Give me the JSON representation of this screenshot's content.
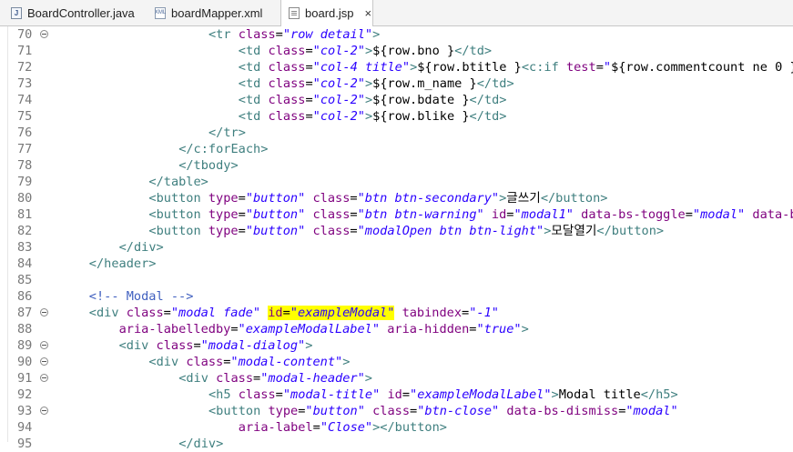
{
  "tabs": [
    {
      "label": "BoardController.java",
      "icon": "java-file-icon"
    },
    {
      "label": "boardMapper.xml",
      "icon": "xml-file-icon"
    },
    {
      "label": "board.jsp",
      "icon": "jsp-file-icon",
      "active": true,
      "close": "×"
    }
  ],
  "lines": [
    {
      "n": "70",
      "fold": true,
      "indent": 20,
      "segs": [
        [
          "t",
          "<tr "
        ],
        [
          "a",
          "class"
        ],
        [
          "plain",
          "="
        ],
        [
          "v",
          "\"row detail\""
        ],
        [
          "t",
          ">"
        ]
      ]
    },
    {
      "n": "71",
      "fold": false,
      "indent": 24,
      "segs": [
        [
          "t",
          "<td "
        ],
        [
          "a",
          "class"
        ],
        [
          "plain",
          "="
        ],
        [
          "v",
          "\"col-2\""
        ],
        [
          "t",
          ">"
        ],
        [
          "plain",
          "${row.bno }"
        ],
        [
          "t",
          "</td>"
        ]
      ]
    },
    {
      "n": "72",
      "fold": false,
      "indent": 24,
      "segs": [
        [
          "t",
          "<td "
        ],
        [
          "a",
          "class"
        ],
        [
          "plain",
          "="
        ],
        [
          "v",
          "\"col-4 title\""
        ],
        [
          "t",
          ">"
        ],
        [
          "plain",
          "${row.btitle }"
        ],
        [
          "t",
          "<c:if "
        ],
        [
          "a",
          "test"
        ],
        [
          "plain",
          "="
        ],
        [
          "v",
          "\""
        ],
        [
          "plain",
          "${row.commentcount ne 0 }"
        ],
        [
          "v",
          "\""
        ],
        [
          "t",
          ">"
        ],
        [
          "plain",
          "&"
        ]
      ]
    },
    {
      "n": "73",
      "fold": false,
      "indent": 24,
      "segs": [
        [
          "t",
          "<td "
        ],
        [
          "a",
          "class"
        ],
        [
          "plain",
          "="
        ],
        [
          "v",
          "\"col-2\""
        ],
        [
          "t",
          ">"
        ],
        [
          "plain",
          "${row.m_name }"
        ],
        [
          "t",
          "</td>"
        ]
      ]
    },
    {
      "n": "74",
      "fold": false,
      "indent": 24,
      "segs": [
        [
          "t",
          "<td "
        ],
        [
          "a",
          "class"
        ],
        [
          "plain",
          "="
        ],
        [
          "v",
          "\"col-2\""
        ],
        [
          "t",
          ">"
        ],
        [
          "plain",
          "${row.bdate }"
        ],
        [
          "t",
          "</td>"
        ]
      ]
    },
    {
      "n": "75",
      "fold": false,
      "indent": 24,
      "segs": [
        [
          "t",
          "<td "
        ],
        [
          "a",
          "class"
        ],
        [
          "plain",
          "="
        ],
        [
          "v",
          "\"col-2\""
        ],
        [
          "t",
          ">"
        ],
        [
          "plain",
          "${row.blike }"
        ],
        [
          "t",
          "</td>"
        ]
      ]
    },
    {
      "n": "76",
      "fold": false,
      "indent": 20,
      "segs": [
        [
          "t",
          "</tr>"
        ]
      ]
    },
    {
      "n": "77",
      "fold": false,
      "indent": 16,
      "segs": [
        [
          "t",
          "</c:forEach>"
        ]
      ]
    },
    {
      "n": "78",
      "fold": false,
      "indent": 16,
      "segs": [
        [
          "t",
          "</tbody>"
        ]
      ]
    },
    {
      "n": "79",
      "fold": false,
      "indent": 12,
      "segs": [
        [
          "t",
          "</table>"
        ]
      ]
    },
    {
      "n": "80",
      "fold": false,
      "indent": 12,
      "segs": [
        [
          "t",
          "<button "
        ],
        [
          "a",
          "type"
        ],
        [
          "plain",
          "="
        ],
        [
          "v",
          "\"button\""
        ],
        [
          "plain",
          " "
        ],
        [
          "a",
          "class"
        ],
        [
          "plain",
          "="
        ],
        [
          "v",
          "\"btn btn-secondary\""
        ],
        [
          "t",
          ">"
        ],
        [
          "plain",
          "글쓰기"
        ],
        [
          "t",
          "</button>"
        ]
      ]
    },
    {
      "n": "81",
      "fold": false,
      "indent": 12,
      "segs": [
        [
          "t",
          "<button "
        ],
        [
          "a",
          "type"
        ],
        [
          "plain",
          "="
        ],
        [
          "v",
          "\"button\""
        ],
        [
          "plain",
          " "
        ],
        [
          "a",
          "class"
        ],
        [
          "plain",
          "="
        ],
        [
          "v",
          "\"btn btn-warning\""
        ],
        [
          "plain",
          " "
        ],
        [
          "a",
          "id"
        ],
        [
          "plain",
          "="
        ],
        [
          "v",
          "\"modal1\""
        ],
        [
          "plain",
          " "
        ],
        [
          "a",
          "data-bs-toggle"
        ],
        [
          "plain",
          "="
        ],
        [
          "v",
          "\"modal\""
        ],
        [
          "plain",
          " "
        ],
        [
          "a",
          "data-bs-t"
        ]
      ]
    },
    {
      "n": "82",
      "fold": false,
      "indent": 12,
      "segs": [
        [
          "t",
          "<button "
        ],
        [
          "a",
          "type"
        ],
        [
          "plain",
          "="
        ],
        [
          "v",
          "\"button\""
        ],
        [
          "plain",
          " "
        ],
        [
          "a",
          "class"
        ],
        [
          "plain",
          "="
        ],
        [
          "v",
          "\"modalOpen btn btn-light\""
        ],
        [
          "t",
          ">"
        ],
        [
          "plain",
          "모달열기"
        ],
        [
          "t",
          "</button>"
        ]
      ]
    },
    {
      "n": "83",
      "fold": false,
      "indent": 8,
      "segs": [
        [
          "t",
          "</div>"
        ]
      ]
    },
    {
      "n": "84",
      "fold": false,
      "indent": 4,
      "segs": [
        [
          "t",
          "</header>"
        ]
      ]
    },
    {
      "n": "85",
      "fold": false,
      "indent": 0,
      "segs": []
    },
    {
      "n": "86",
      "fold": false,
      "indent": 4,
      "segs": [
        [
          "cm",
          "<!-- Modal -->"
        ]
      ]
    },
    {
      "n": "87",
      "fold": true,
      "indent": 4,
      "segs": [
        [
          "t",
          "<div "
        ],
        [
          "a",
          "class"
        ],
        [
          "plain",
          "="
        ],
        [
          "v",
          "\"modal fade\""
        ],
        [
          "plain",
          " "
        ],
        [
          "hla",
          "id"
        ],
        [
          "hlp",
          "="
        ],
        [
          "hlv",
          "\"exampleModal\""
        ],
        [
          "plain",
          " "
        ],
        [
          "a",
          "tabindex"
        ],
        [
          "plain",
          "="
        ],
        [
          "v",
          "\"-1\""
        ]
      ]
    },
    {
      "n": "88",
      "fold": false,
      "indent": 8,
      "segs": [
        [
          "a",
          "aria-labelledby"
        ],
        [
          "plain",
          "="
        ],
        [
          "v",
          "\"exampleModalLabel\""
        ],
        [
          "plain",
          " "
        ],
        [
          "a",
          "aria-hidden"
        ],
        [
          "plain",
          "="
        ],
        [
          "v",
          "\"true\""
        ],
        [
          "t",
          ">"
        ]
      ]
    },
    {
      "n": "89",
      "fold": true,
      "indent": 8,
      "segs": [
        [
          "t",
          "<div "
        ],
        [
          "a",
          "class"
        ],
        [
          "plain",
          "="
        ],
        [
          "v",
          "\"modal-dialog\""
        ],
        [
          "t",
          ">"
        ]
      ]
    },
    {
      "n": "90",
      "fold": true,
      "indent": 12,
      "segs": [
        [
          "t",
          "<div "
        ],
        [
          "a",
          "class"
        ],
        [
          "plain",
          "="
        ],
        [
          "v",
          "\"modal-content\""
        ],
        [
          "t",
          ">"
        ]
      ]
    },
    {
      "n": "91",
      "fold": true,
      "indent": 16,
      "segs": [
        [
          "t",
          "<div "
        ],
        [
          "a",
          "class"
        ],
        [
          "plain",
          "="
        ],
        [
          "v",
          "\"modal-header\""
        ],
        [
          "t",
          ">"
        ]
      ]
    },
    {
      "n": "92",
      "fold": false,
      "indent": 20,
      "segs": [
        [
          "t",
          "<h5 "
        ],
        [
          "a",
          "class"
        ],
        [
          "plain",
          "="
        ],
        [
          "v",
          "\"modal-title\""
        ],
        [
          "plain",
          " "
        ],
        [
          "a",
          "id"
        ],
        [
          "plain",
          "="
        ],
        [
          "v",
          "\"exampleModalLabel\""
        ],
        [
          "t",
          ">"
        ],
        [
          "plain",
          "Modal title"
        ],
        [
          "t",
          "</h5>"
        ]
      ]
    },
    {
      "n": "93",
      "fold": true,
      "indent": 20,
      "segs": [
        [
          "t",
          "<button "
        ],
        [
          "a",
          "type"
        ],
        [
          "plain",
          "="
        ],
        [
          "v",
          "\"button\""
        ],
        [
          "plain",
          " "
        ],
        [
          "a",
          "class"
        ],
        [
          "plain",
          "="
        ],
        [
          "v",
          "\"btn-close\""
        ],
        [
          "plain",
          " "
        ],
        [
          "a",
          "data-bs-dismiss"
        ],
        [
          "plain",
          "="
        ],
        [
          "v",
          "\"modal\""
        ]
      ]
    },
    {
      "n": "94",
      "fold": false,
      "indent": 24,
      "segs": [
        [
          "a",
          "aria-label"
        ],
        [
          "plain",
          "="
        ],
        [
          "v",
          "\"Close\""
        ],
        [
          "t",
          "></button>"
        ]
      ]
    },
    {
      "n": "95",
      "fold": false,
      "indent": 16,
      "segs": [
        [
          "t",
          "</div>"
        ]
      ]
    }
  ]
}
